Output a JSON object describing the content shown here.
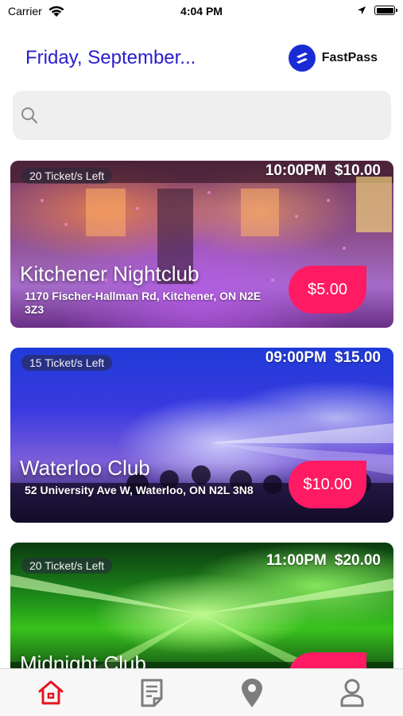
{
  "status_bar": {
    "carrier": "Carrier",
    "time": "4:04 PM"
  },
  "header": {
    "date_title": "Friday, September...",
    "brand_name": "FastPass"
  },
  "search": {
    "placeholder": ""
  },
  "events": [
    {
      "tickets_left": "20 Ticket/s Left",
      "time": "10:00PM",
      "price_top": "$10.00",
      "name": "Kitchener Nightclub",
      "address": "1170 Fischer-Hallman Rd, Kitchener, ON N2E 3Z3",
      "badge_price": "$5.00"
    },
    {
      "tickets_left": "15 Ticket/s Left",
      "time": "09:00PM",
      "price_top": "$15.00",
      "name": "Waterloo Club",
      "address": "52 University Ave W, Waterloo, ON N2L 3N8",
      "badge_price": "$10.00"
    },
    {
      "tickets_left": "20 Ticket/s Left",
      "time": "11:00PM",
      "price_top": "$20.00",
      "name": "Midnight Club",
      "address": "",
      "badge_price": ""
    }
  ],
  "tabbar": {
    "items": [
      {
        "icon": "home-icon",
        "active": true
      },
      {
        "icon": "document-icon",
        "active": false
      },
      {
        "icon": "location-pin-icon",
        "active": false
      },
      {
        "icon": "user-icon",
        "active": false
      }
    ]
  },
  "colors": {
    "accent": "#2a1ccf",
    "brand_blue": "#1a2bd6",
    "badge_pink": "#ff1a64",
    "tab_active": "#e8141e",
    "tab_inactive": "#7d7d7d"
  }
}
